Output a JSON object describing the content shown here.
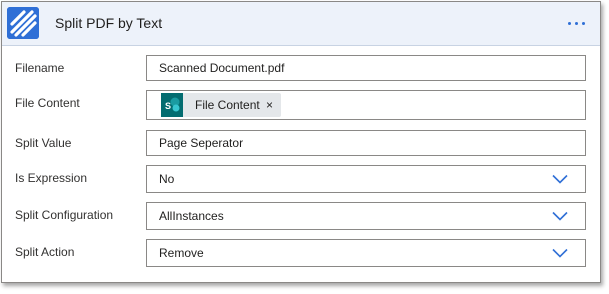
{
  "action": {
    "title": "Split PDF by Text",
    "icon": "diagonal-stripes-logo-icon",
    "menu_icon": "more-options-icon",
    "accent_color": "#2f6fd6"
  },
  "fields": {
    "filename": {
      "label": "Filename",
      "value": "Scanned Document.pdf"
    },
    "file_content": {
      "label": "File Content",
      "token_label": "File Content",
      "token_icon": "sharepoint-icon",
      "token_remove": "×"
    },
    "split_value": {
      "label": "Split Value",
      "value": "Page Seperator"
    },
    "is_expression": {
      "label": "Is Expression",
      "value": "No"
    },
    "split_configuration": {
      "label": "Split Configuration",
      "value": "AllInstances"
    },
    "split_action": {
      "label": "Split Action",
      "value": "Remove"
    }
  }
}
